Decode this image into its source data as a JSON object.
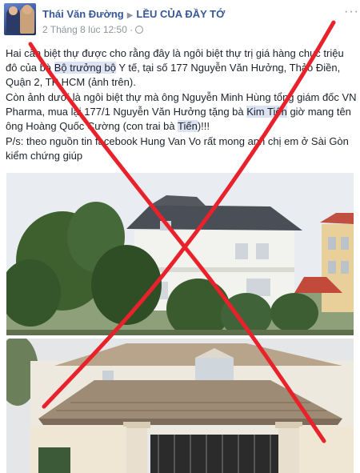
{
  "header": {
    "author": "Thái Văn Đường",
    "arrow": "▶",
    "page_name": "LỀU CỦA ĐẦY TỚ",
    "timestamp": "2 Tháng 8 lúc 12:50 ·",
    "more": "···"
  },
  "post": {
    "p1_a": "Hai căn biệt thự được cho rằng đây là ngôi biệt thự trị giá hàng chục triệu đô của bà ",
    "p1_hl": "Bộ trưởng bộ",
    "p1_b": " Y tế, tại số 177 Nguyễn Văn Hưởng, Thảo Điền, Quận 2, TP HCM (ảnh trên).",
    "p2_a": "Còn ảnh dưới là ngôi biệt thự mà ông Nguyễn Minh Hùng tổng giám đốc VN Pharma, mua lại 177/1 Nguyễn Văn Hưởng tặng bà ",
    "p2_hl1": "Kim Tiến",
    "p2_b": " giờ mang tên ông Hoàng Quốc Cường (con trai bà ",
    "p2_hl2": "Tiến",
    "p2_c": ")!!!",
    "p3": "P/s: theo nguồn tin facebook Hung Van Vo rất mong anh chị em ở Sài Gòn kiểm chứng giúp"
  },
  "colors": {
    "link": "#365899",
    "meta": "#90949c",
    "highlight": "#dce3f2",
    "cross": "#e8212b"
  },
  "icons": [
    "arrow-icon",
    "globe-icon",
    "more-icon"
  ]
}
